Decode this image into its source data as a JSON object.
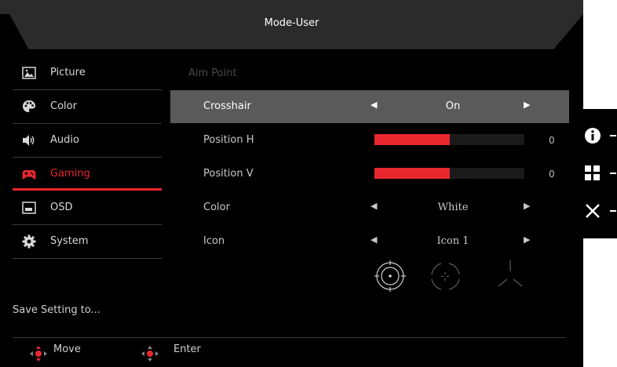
{
  "header": {
    "title": "Mode-User"
  },
  "sidebar": {
    "items": [
      {
        "label": "Picture",
        "icon": "picture-icon"
      },
      {
        "label": "Color",
        "icon": "palette-icon"
      },
      {
        "label": "Audio",
        "icon": "speaker-icon"
      },
      {
        "label": "Gaming",
        "icon": "gamepad-icon",
        "active": true
      },
      {
        "label": "OSD",
        "icon": "osd-icon"
      },
      {
        "label": "System",
        "icon": "gear-icon"
      }
    ],
    "save_setting": "Save Setting to..."
  },
  "main": {
    "section_title": "Aim Point",
    "rows": [
      {
        "label": "Crosshair",
        "value": "On",
        "type": "select",
        "selected": true
      },
      {
        "label": "Position H",
        "value": "0",
        "type": "slider",
        "level": 0.5
      },
      {
        "label": "Position V",
        "value": "0",
        "type": "slider",
        "level": 0.5
      },
      {
        "label": "Color",
        "value": "White",
        "type": "select"
      },
      {
        "label": "Icon",
        "value": "Icon 1",
        "type": "select"
      }
    ],
    "crosshair_icons": [
      "crosshair-1-icon",
      "crosshair-2-icon",
      "crosshair-3-icon"
    ]
  },
  "footer": {
    "move_label": "Move",
    "enter_label": "Enter"
  },
  "hotkeys": [
    "info-icon",
    "menu-grid-icon",
    "close-icon"
  ],
  "colors": {
    "accent": "#e8282e",
    "background": "#000000",
    "selected_row": "#5a5a5a"
  }
}
